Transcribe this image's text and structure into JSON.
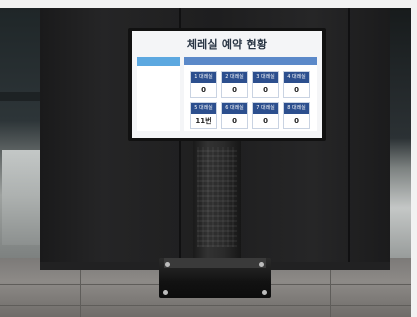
{
  "kiosk": {
    "title": "체레실 예약 현황",
    "left_badge": "",
    "room_header": "",
    "rooms": [
      {
        "label": "1 대레실",
        "count": "0"
      },
      {
        "label": "2 대레실",
        "count": "0"
      },
      {
        "label": "3 대레실",
        "count": "0"
      },
      {
        "label": "4 대레실",
        "count": "0"
      },
      {
        "label": "5 대레실",
        "count": "11번"
      },
      {
        "label": "6 대레실",
        "count": "0"
      },
      {
        "label": "7 대레실",
        "count": "0"
      },
      {
        "label": "8 대레실",
        "count": "0"
      }
    ]
  },
  "colors": {
    "screen_bg": "#f4f5f7",
    "room_label_bg": "#2c4f8e",
    "header_bar": "#5b89c9",
    "left_badge": "#5ca8e0",
    "wall": "#222223",
    "floor": "#8a8784"
  }
}
